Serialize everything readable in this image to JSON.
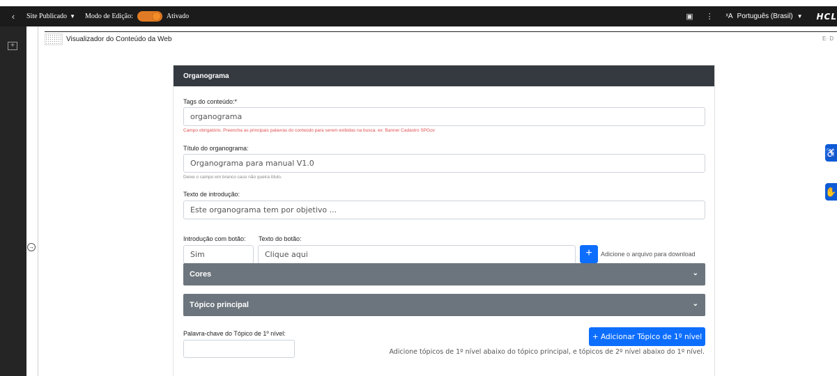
{
  "topbar": {
    "back_icon": "chevron-left-icon",
    "site_status": "Site Publicado",
    "edit_mode_label": "Modo de Edição:",
    "edit_mode_value": "Ativado",
    "language": "Português (Brasil)",
    "brand": "HCL",
    "toggle_color": "#e07a24"
  },
  "leftrail": {
    "plus": "+",
    "collapse": "→"
  },
  "wcv": {
    "title": "Visualizador do Conteúdo da Web",
    "right": "E· D"
  },
  "form": {
    "header": "Organograma",
    "tags_label": "Tags do conteúdo:*",
    "tags_value": "organograma",
    "tags_help": "Campo obrigatório. Preencha as principais palavras do conteúdo para serem exibidas na busca. ex: Banner Cadastro SPGov",
    "title_label": "Título do organograma:",
    "title_value": "Organograma para manual V1.0",
    "title_help": "Deixe o campo em branco caso não queira título.",
    "intro_label": "Texto de introdução:",
    "intro_value": "Este organograma tem por objetivo ...",
    "intro_button_label": "Introdução com botão:",
    "intro_button_value": "Sim",
    "button_text_label": "Texto do botão:",
    "button_text_value": "Clique aqui",
    "add_file_label": "Adicione o arquivo para download",
    "accordion_colors": "Cores",
    "accordion_main_topic": "Tópico principal",
    "keyword_label": "Palavra-chave do Tópico de 1º nível:",
    "keyword_value": "",
    "add_topic_button": "+ Adicionar Tópico de 1º nível",
    "add_topic_desc": "Adicione tópicos de 1º nível abaixo do tópico principal, e tópicos de 2º nível abaixo do 1º nível.",
    "header_color": "#343a40",
    "accordion_color": "#6c757d",
    "primary_color": "#0d6efd",
    "error_color": "#e05050"
  }
}
